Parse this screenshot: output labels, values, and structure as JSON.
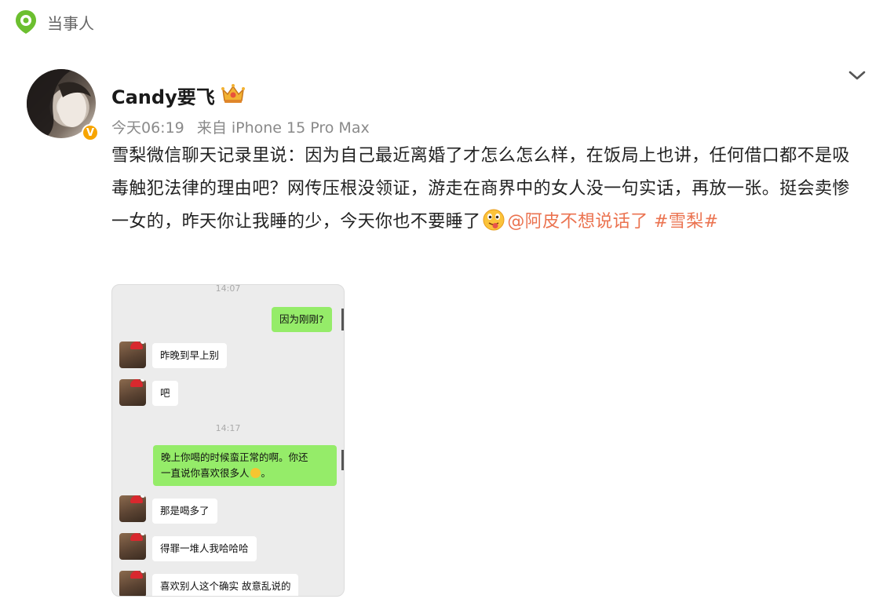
{
  "tag": {
    "label": "当事人",
    "icon": "location-pin-icon"
  },
  "author": {
    "name": "Candy要飞",
    "badge_icon": "crown-icon",
    "verified_mark": "V",
    "time": "今天06:19",
    "source": "来自 iPhone 15 Pro Max"
  },
  "post": {
    "text_main": "雪梨微信聊天记录里说：因为自己最近离婚了才怎么怎么样，在饭局上也讲，任何借口都不是吸毒触犯法律的理由吧？网传压根没领证，游走在商界中的女人没一句实话，再放一张。挺会卖惨一女的，昨天你让我睡的少，今天你也不要睡了",
    "emoji": "tongue-out-emoji",
    "mention": "@阿皮不想说话了",
    "hashtag": "#雪梨#"
  },
  "chat_image": {
    "times": [
      "14:07",
      "14:17"
    ],
    "messages": [
      {
        "side": "me",
        "text": "因为刚刚?"
      },
      {
        "side": "other",
        "text": "昨晚到早上别"
      },
      {
        "side": "other",
        "text": "吧"
      },
      {
        "side": "me",
        "text_line1": "晚上你喝的时候蛮正常的啊。你还",
        "text_line2": "一直说你喜欢很多人",
        "text_end": "。"
      },
      {
        "side": "other",
        "text": "那是喝多了"
      },
      {
        "side": "other",
        "text": "得罪一堆人我哈哈哈"
      },
      {
        "side": "other",
        "text": "喜欢别人这个确实 故意乱说的"
      }
    ]
  },
  "colors": {
    "link": "#eb7350",
    "bubble_me": "#95ec69",
    "verified": "#f7a400"
  }
}
